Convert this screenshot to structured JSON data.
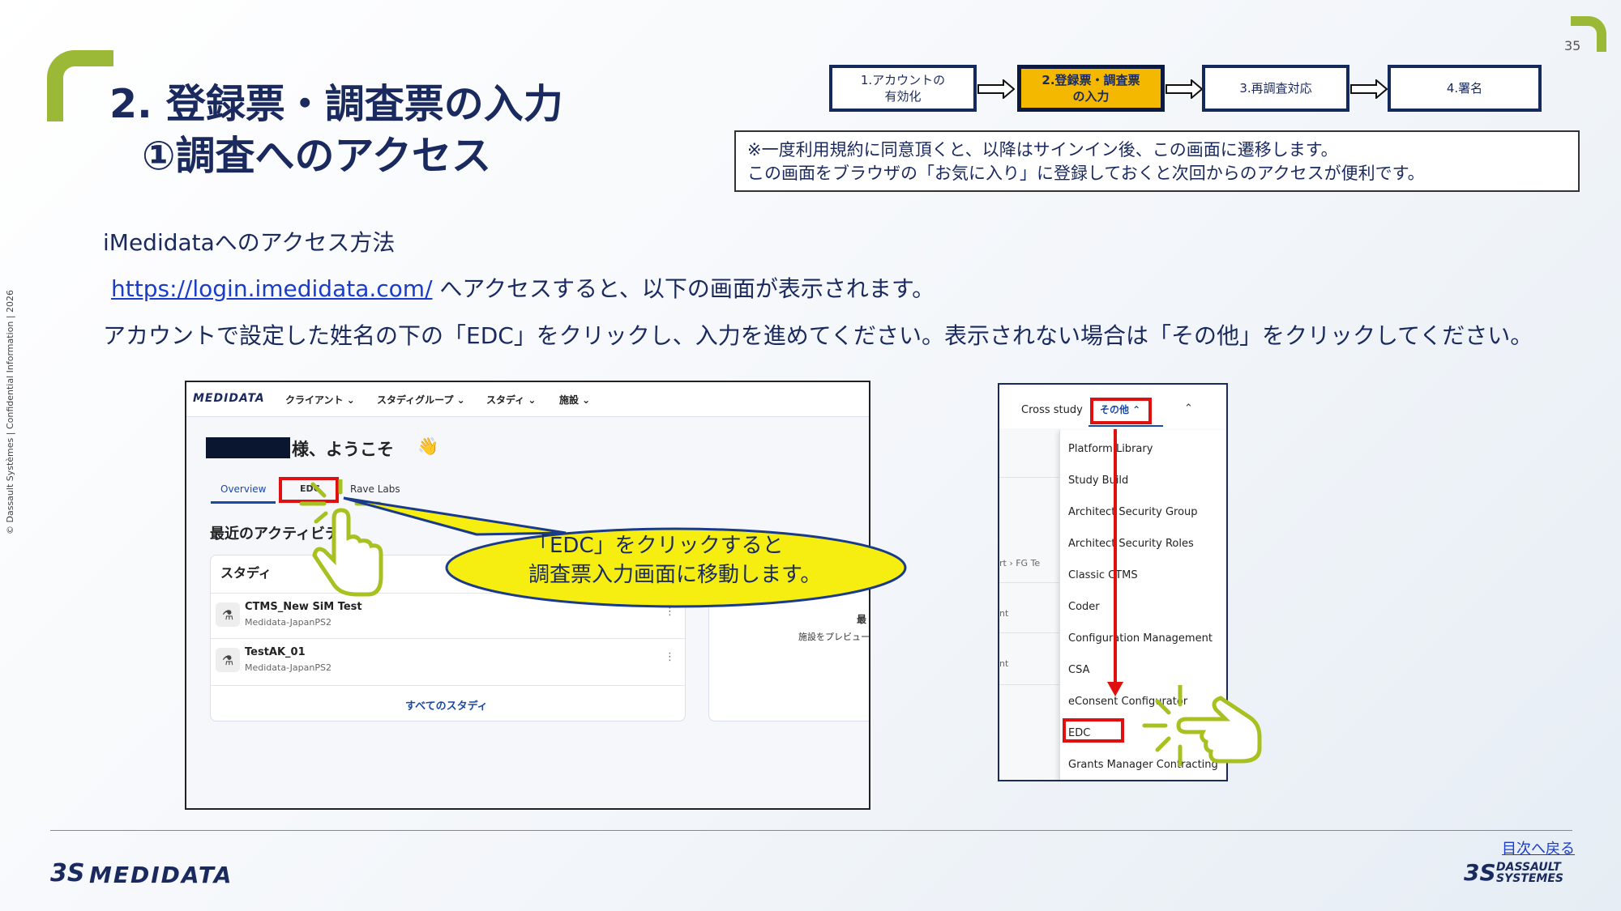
{
  "page_number": "35",
  "title_line1": "2. 登録票・調査票の入力",
  "title_line2": "①調査へのアクセス",
  "side_text": "© Dassault Systèmes | Confidential Information | 2026",
  "steps": [
    {
      "line1": "1.アカウントの",
      "line2": "有効化"
    },
    {
      "line1": "2.登録票・調査票",
      "line2": "の入力"
    },
    {
      "line1": "3.再調査対応",
      "line2": ""
    },
    {
      "line1": "4.署名",
      "line2": ""
    }
  ],
  "note": {
    "line1": "※一度利用規約に同意頂くと、以降はサインイン後、この画面に遷移します。",
    "line2": "この画面をブラウザの「お気に入り」に登録しておくと次回からのアクセスが便利です。"
  },
  "body": {
    "heading": "iMedidataへのアクセス方法",
    "link_text": "https://login.imedidata.com/",
    "link_suffix": " へアクセスすると、以下の画面が表示されます。",
    "instruction": "アカウントで設定した姓名の下の「EDC」をクリックし、入力を進めてください。表示されない場合は「その他」をクリックしてください。"
  },
  "shot1": {
    "logo": "MEDIDATA",
    "nav": [
      "クライアント ⌄",
      "スタディグループ ⌄",
      "スタディ ⌄",
      "施設 ⌄"
    ],
    "welcome": "様、ようこそ",
    "wave": "👋",
    "tabs": [
      "Overview",
      "EDC",
      "Rave Labs"
    ],
    "section_title": "最近のアクティビティ",
    "card_title": "スタディ",
    "studies": [
      {
        "name": "CTMS_New SiM Test",
        "sub": "Medidata-JapanPS2"
      },
      {
        "name": "TestAK_01",
        "sub": "Medidata-JapanPS2"
      }
    ],
    "all_studies": "すべてのスタディ",
    "right_card_a": "最",
    "right_card_b": "施設をプレビュー"
  },
  "callout": {
    "line1": "「EDC」をクリックすると",
    "line2": "調査票入力画面に移動します。"
  },
  "shot2": {
    "cross_study": "Cross study",
    "other": "その他 ⌃",
    "caret": "⌃",
    "left_fragments": [
      "rt › FG Te",
      "nt",
      "nt"
    ],
    "dropdown": [
      "Platform Library",
      "Study Build",
      "Architect Security Group",
      "Architect Security Roles",
      "Classic CTMS",
      "Coder",
      "Configuration Management",
      "CSA",
      "eConsent Configurator",
      "EDC",
      "Grants Manager Contracting"
    ]
  },
  "footer": {
    "logo": "MEDIDATA",
    "back_link": "目次へ戻る",
    "ds_line1": "DASSAULT",
    "ds_line2": "SYSTEMES"
  },
  "colors": {
    "accent_green": "#9bb836",
    "navy": "#1a2a5e",
    "active_step": "#f5b800",
    "highlight_red": "#e01010",
    "callout_fill": "#f5ee10"
  }
}
